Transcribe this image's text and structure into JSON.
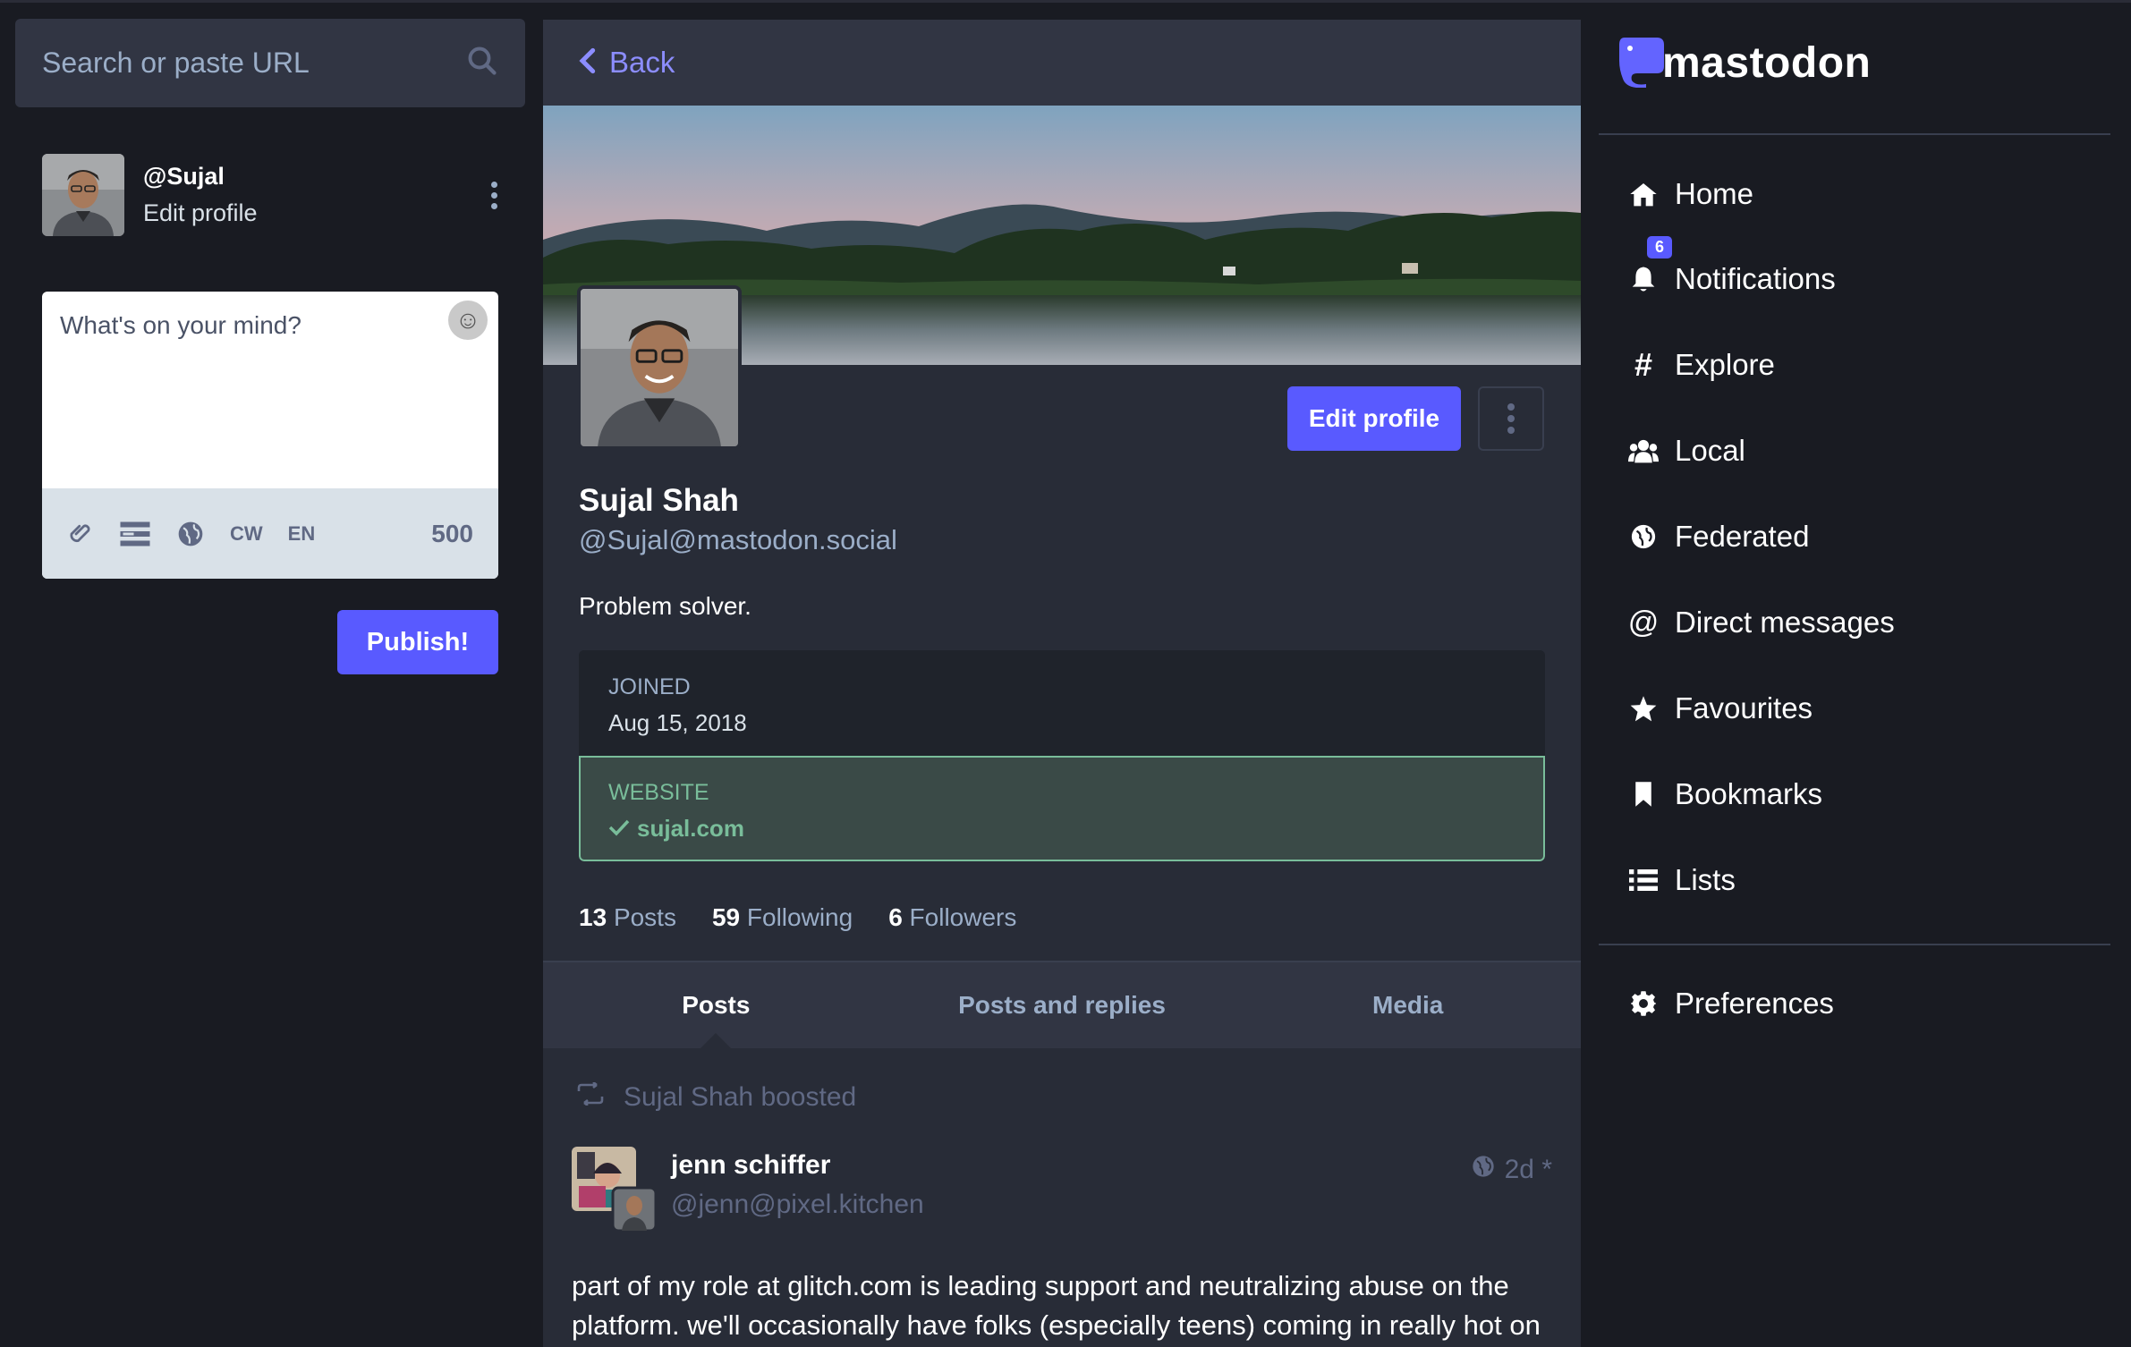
{
  "search": {
    "placeholder": "Search or paste URL",
    "icon": "search-icon"
  },
  "account": {
    "handle": "@Sujal",
    "edit_label": "Edit profile"
  },
  "compose": {
    "placeholder": "What's on your mind?",
    "tools": {
      "cw": "CW",
      "lang": "EN"
    },
    "char_count": "500",
    "publish_label": "Publish!"
  },
  "profile": {
    "back_label": "Back",
    "display_name": "Sujal Shah",
    "acct": "@Sujal@mastodon.social",
    "bio": "Problem solver.",
    "edit_profile_label": "Edit profile",
    "fields": [
      {
        "key": "JOINED",
        "value": "Aug 15, 2018"
      },
      {
        "key": "WEBSITE",
        "value": "sujal.com",
        "verified": true
      }
    ],
    "stats": {
      "posts_count": "13",
      "posts_label": "Posts",
      "following_count": "59",
      "following_label": "Following",
      "followers_count": "6",
      "followers_label": "Followers"
    },
    "tabs": [
      "Posts",
      "Posts and replies",
      "Media"
    ]
  },
  "timeline": {
    "boost_text": "Sujal Shah boosted",
    "post": {
      "author": "jenn schiffer",
      "acct": "@jenn@pixel.kitchen",
      "time": "2d *",
      "body": "part of my role at glitch.com is leading support and neutralizing abuse on the platform. we'll occasionally have folks (especially teens) coming in really hot on the support queue, saying nasty stuff that i know they learn from mostly. Being"
    }
  },
  "brand": {
    "name": "mastodon",
    "accent": "#595aff"
  },
  "nav": {
    "home": "Home",
    "notifications": "Notifications",
    "notifications_badge": "6",
    "explore": "Explore",
    "local": "Local",
    "federated": "Federated",
    "direct": "Direct messages",
    "favourites": "Favourites",
    "bookmarks": "Bookmarks",
    "lists": "Lists",
    "preferences": "Preferences"
  }
}
